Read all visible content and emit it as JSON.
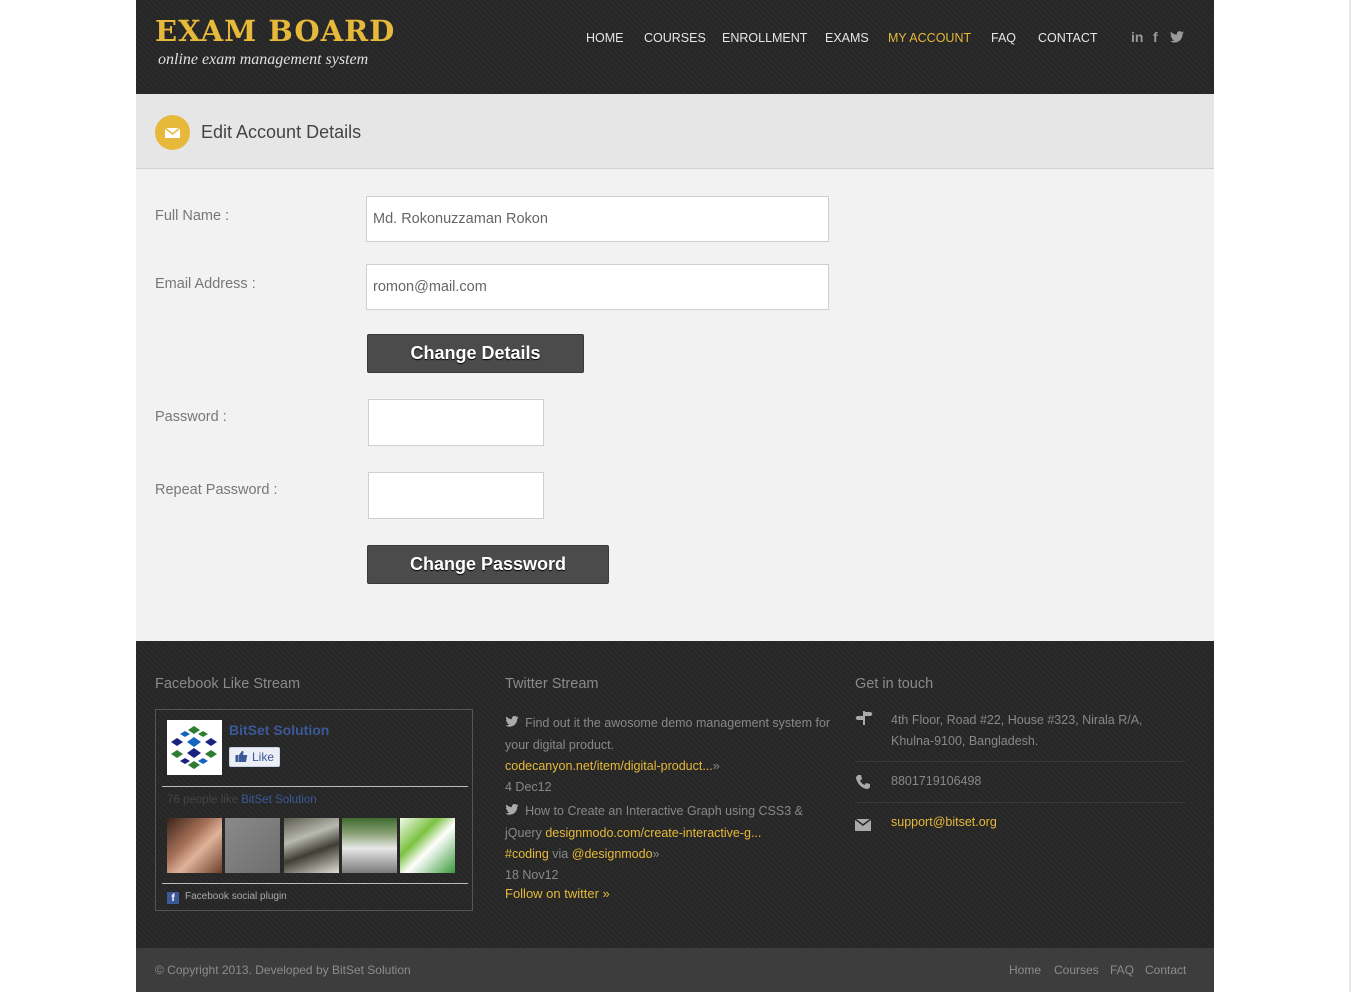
{
  "brand": {
    "title": "EXAM BOARD",
    "subtitle": "online exam management system",
    "accent": "#e6b93a"
  },
  "nav": {
    "items": [
      "HOME",
      "COURSES",
      "ENROLLMENT",
      "EXAMS",
      "MY ACCOUNT",
      "FAQ",
      "CONTACT"
    ],
    "active": "MY ACCOUNT"
  },
  "social": [
    "linkedin-icon",
    "facebook-icon",
    "twitter-icon"
  ],
  "page": {
    "title": "Edit Account Details",
    "icon": "envelope-icon"
  },
  "form": {
    "full_name_label": "Full Name :",
    "full_name_value": "Md. Rokonuzzaman Rokon",
    "email_label": "Email Address :",
    "email_value": "romon@mail.com",
    "change_details_button": "Change Details",
    "password_label": "Password :",
    "repeat_password_label": "Repeat Password :",
    "change_password_button": "Change Password"
  },
  "footer": {
    "facebook": {
      "title": "Facebook Like Stream",
      "page_name": "BitSet Solution",
      "like_label": "Like",
      "count_text": "76 people like",
      "count_link": "BitSet Solution",
      "plugin_text": "Facebook social plugin"
    },
    "twitter": {
      "title": "Twitter Stream",
      "tweets": [
        {
          "text": "Find out it the awosome demo management system for your digital product.",
          "link": "codecanyon.net/item/digital-product...",
          "date": "4 Dec12"
        },
        {
          "text": "How to Create an Interactive Graph using CSS3 & jQuery",
          "link": "designmodo.com/create-interactive-g...",
          "hashtag": "#coding",
          "via": "via",
          "mention": "@designmodo",
          "date": "18 Nov12"
        }
      ],
      "follow": "Follow on twitter »"
    },
    "contact": {
      "title": "Get in touch",
      "address": "4th Floor, Road #22, House #323, Nirala R/A, Khulna-9100, Bangladesh.",
      "phone": "8801719106498",
      "email": "support@bitset.org"
    }
  },
  "bottom": {
    "copyright": "© Copyright 2013. Developed by BitSet Solution",
    "links": [
      "Home",
      "Courses",
      "FAQ",
      "Contact"
    ]
  }
}
